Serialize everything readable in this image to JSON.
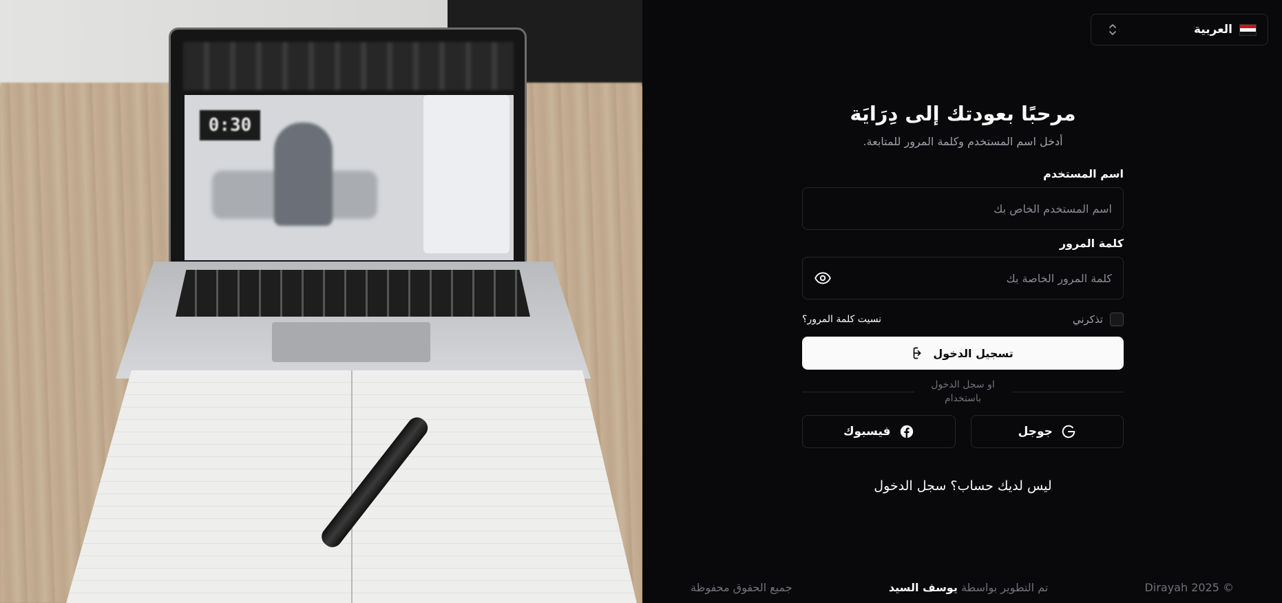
{
  "language_selector": {
    "label": "العربية",
    "flag_icon": "egypt-flag-icon"
  },
  "header": {
    "title": "مرحبًا بعودتك إلى دِرَايَة",
    "subtitle": "أدخل اسم المستخدم وكلمة المرور للمتابعة."
  },
  "form": {
    "username_label": "اسم المستخدم",
    "username_placeholder": "اسم المستخدم الخاص بك",
    "username_value": "",
    "password_label": "كلمة المرور",
    "password_placeholder": "كلمة المرور الخاصة بك",
    "password_value": "",
    "remember_label": "تذكرني",
    "remember_checked": false,
    "forgot_label": "نسيت كلمة المرور؟",
    "login_label": "تسجيل الدخول",
    "divider_text": "او سجل الدخول باستخدام"
  },
  "social": {
    "google_label": "جوجل",
    "facebook_label": "فيسبوك"
  },
  "register_link": "ليس لديك حساب؟ سجل الدخول",
  "footer": {
    "rights": "جميع الحقوق محفوظة",
    "developed_by_prefix": "تم التطوير بواسطة",
    "developer_name": "يوسف السيد",
    "copyright": "Dirayah 2025 ©"
  },
  "colors": {
    "background": "#09090b",
    "border": "#27272a",
    "primary_button": "#fafafa",
    "muted_text": "#a1a1aa"
  }
}
